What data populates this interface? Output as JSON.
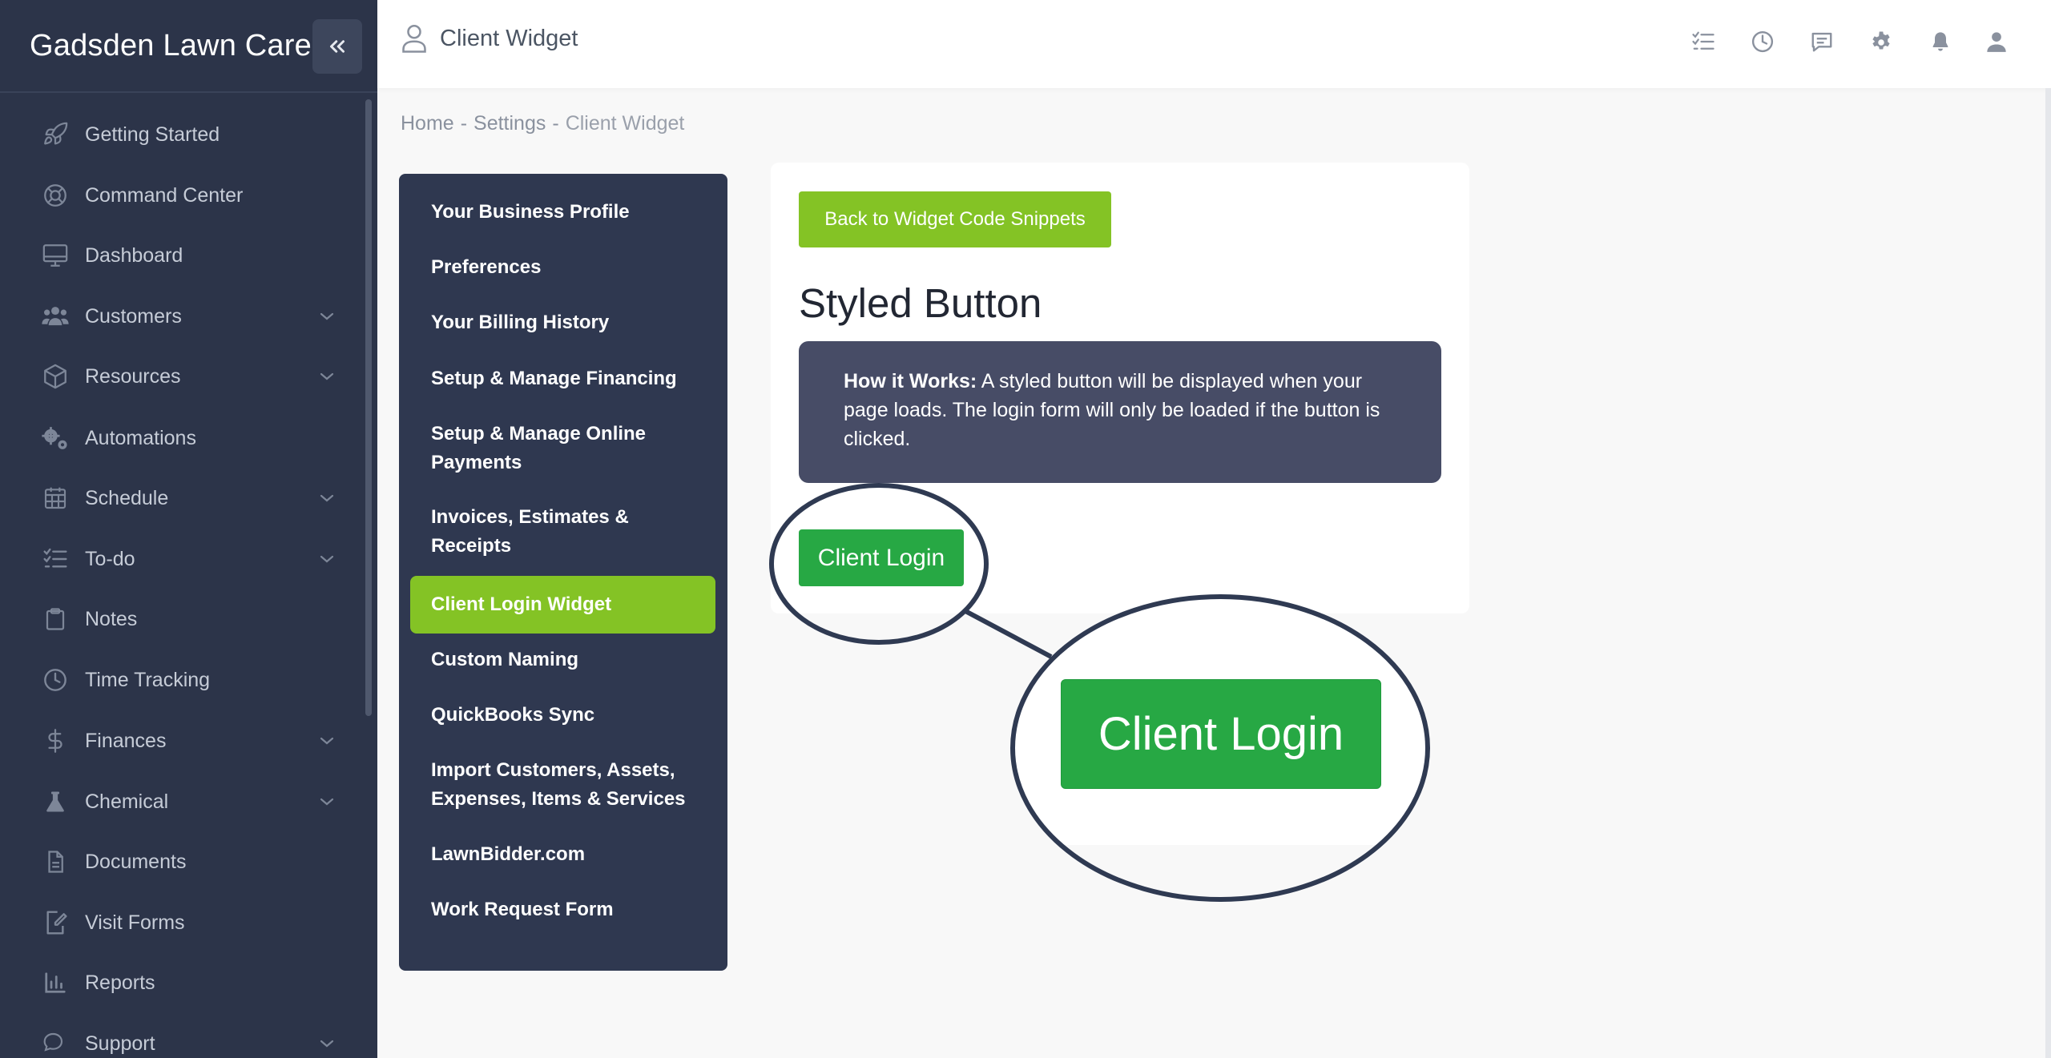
{
  "app": {
    "brand": "Gadsden Lawn Care"
  },
  "sidebar": {
    "items": [
      {
        "label": "Getting Started",
        "icon": "rocket-icon",
        "has_children": false
      },
      {
        "label": "Command Center",
        "icon": "lifebuoy-icon",
        "has_children": false
      },
      {
        "label": "Dashboard",
        "icon": "monitor-icon",
        "has_children": false
      },
      {
        "label": "Customers",
        "icon": "users-icon",
        "has_children": true
      },
      {
        "label": "Resources",
        "icon": "box-icon",
        "has_children": true
      },
      {
        "label": "Automations",
        "icon": "gears-icon",
        "has_children": false
      },
      {
        "label": "Schedule",
        "icon": "calendar-icon",
        "has_children": true
      },
      {
        "label": "To-do",
        "icon": "checklist-icon",
        "has_children": true
      },
      {
        "label": "Notes",
        "icon": "clipboard-icon",
        "has_children": false
      },
      {
        "label": "Time Tracking",
        "icon": "clock-icon",
        "has_children": false
      },
      {
        "label": "Finances",
        "icon": "dollar-icon",
        "has_children": true
      },
      {
        "label": "Chemical",
        "icon": "flask-icon",
        "has_children": true
      },
      {
        "label": "Documents",
        "icon": "document-icon",
        "has_children": false
      },
      {
        "label": "Visit Forms",
        "icon": "form-edit-icon",
        "has_children": false
      },
      {
        "label": "Reports",
        "icon": "bar-chart-icon",
        "has_children": false
      },
      {
        "label": "Support",
        "icon": "chat-icon",
        "has_children": true
      }
    ]
  },
  "header": {
    "title": "Client Widget",
    "icons": [
      "tasks-icon",
      "history-icon",
      "message-icon",
      "settings-icon",
      "bell-icon",
      "user-icon"
    ]
  },
  "breadcrumb": {
    "home": "Home",
    "settings": "Settings",
    "current": "Client Widget",
    "sep": "-"
  },
  "settings_menu": {
    "items": [
      "Your Business Profile",
      "Preferences",
      "Your Billing History",
      "Setup & Manage Financing",
      "Setup & Manage Online Payments",
      "Invoices, Estimates & Receipts",
      "Client Login Widget",
      "Custom Naming",
      "QuickBooks Sync",
      "Import Customers, Assets, Expenses, Items & Services",
      "LawnBidder.com",
      "Work Request Form"
    ],
    "active": "Client Login Widget"
  },
  "widget": {
    "back_button": "Back to Widget Code Snippets",
    "heading": "Styled Button",
    "info_label": "How it Works:",
    "info_text": " A styled button will be displayed when your page loads. The login form will only be loaded if the button is clicked.",
    "client_button": "Client Login",
    "zoom_button": "Client Login"
  },
  "colors": {
    "sidebar_bg": "#2c3449",
    "accent_green": "#84c325",
    "login_green": "#27a844",
    "info_bg": "#474c66"
  }
}
